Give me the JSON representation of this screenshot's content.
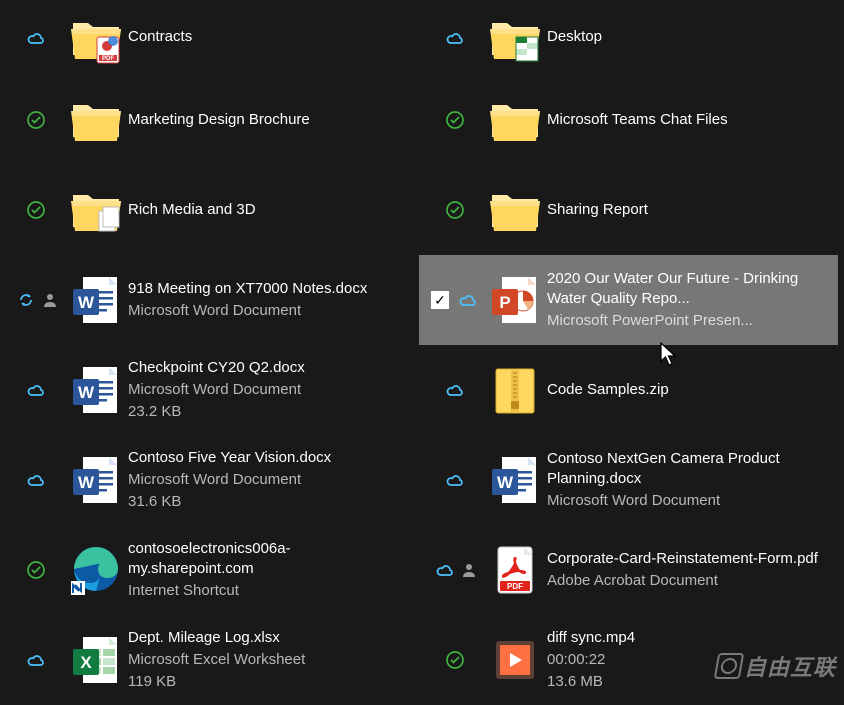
{
  "watermark": "自由互联",
  "items": [
    {
      "status": "cloud",
      "icon": "folder-pdf",
      "name": "Contracts",
      "type": "",
      "size": ""
    },
    {
      "status": "cloud",
      "icon": "folder-excel",
      "name": "Desktop",
      "type": "",
      "size": ""
    },
    {
      "status": "synced",
      "icon": "folder",
      "name": "Marketing Design Brochure",
      "type": "",
      "size": ""
    },
    {
      "status": "synced",
      "icon": "folder",
      "name": "Microsoft Teams Chat Files",
      "type": "",
      "size": ""
    },
    {
      "status": "synced",
      "icon": "folder-multi",
      "name": "Rich Media and 3D",
      "type": "",
      "size": ""
    },
    {
      "status": "synced",
      "icon": "folder",
      "name": "Sharing Report",
      "type": "",
      "size": ""
    },
    {
      "status": "syncing-person",
      "icon": "word",
      "name": "918 Meeting on XT7000 Notes.docx",
      "type": "Microsoft Word Document",
      "size": ""
    },
    {
      "status": "cloud",
      "icon": "powerpoint",
      "name": "2020 Our Water Our Future - Drinking Water Quality Repo...",
      "type": "Microsoft PowerPoint Presen...",
      "size": "",
      "selected": true,
      "checked": true
    },
    {
      "status": "cloud",
      "icon": "word",
      "name": "Checkpoint CY20 Q2.docx",
      "type": "Microsoft Word Document",
      "size": "23.2 KB"
    },
    {
      "status": "cloud",
      "icon": "zip",
      "name": "Code Samples.zip",
      "type": "",
      "size": ""
    },
    {
      "status": "cloud",
      "icon": "word",
      "name": "Contoso Five Year Vision.docx",
      "type": "Microsoft Word Document",
      "size": "31.6 KB"
    },
    {
      "status": "cloud",
      "icon": "word",
      "name": "Contoso NextGen Camera Product Planning.docx",
      "type": "Microsoft Word Document",
      "size": ""
    },
    {
      "status": "synced",
      "icon": "edge-shortcut",
      "name": "contosoelectronics006a-my.sharepoint.com",
      "type": "Internet Shortcut",
      "size": ""
    },
    {
      "status": "cloud-person",
      "icon": "pdf",
      "name": "Corporate-Card-Reinstatement-Form.pdf",
      "type": "Adobe Acrobat Document",
      "size": ""
    },
    {
      "status": "cloud",
      "icon": "excel",
      "name": "Dept. Mileage Log.xlsx",
      "type": "Microsoft Excel Worksheet",
      "size": "119 KB"
    },
    {
      "status": "synced",
      "icon": "video",
      "name": "diff sync.mp4",
      "type": "00:00:22",
      "size": "13.6 MB"
    }
  ]
}
